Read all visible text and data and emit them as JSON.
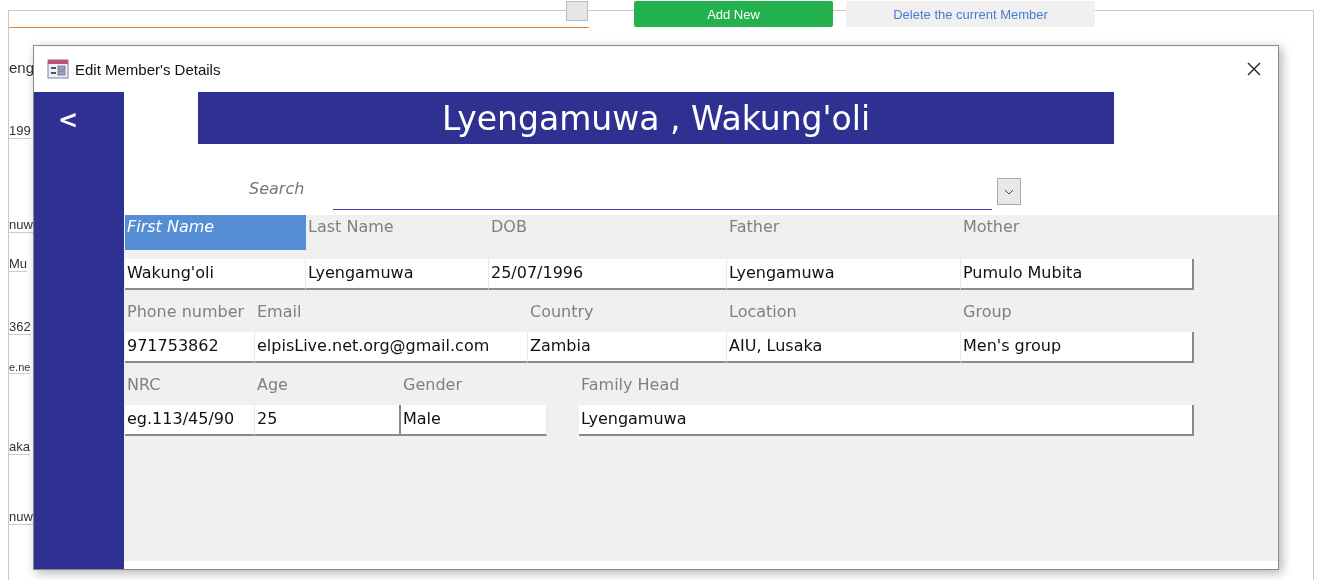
{
  "background_window": {
    "buttons": [
      {
        "label": "Add New",
        "kind": "primary"
      },
      {
        "label": "Delete the current Member",
        "kind": "secondary"
      }
    ],
    "fragments": [
      "eng",
      "199",
      "nuw",
      "Mu",
      "362",
      "e.ne",
      "aka",
      "nuw"
    ]
  },
  "dialog": {
    "title": "Edit Member's Details",
    "back": "<",
    "header": "Lyengamuwa , Wakung'oli",
    "search": {
      "label": "Search"
    },
    "rows": [
      [
        {
          "label": "First Name",
          "value": "Wakung'oli",
          "selected": true,
          "kind": "text"
        },
        {
          "label": "Last Name",
          "value": "Lyengamuwa",
          "selected": false,
          "kind": "text"
        },
        {
          "label": "DOB",
          "value": "25/07/1996",
          "selected": false,
          "kind": "text"
        },
        {
          "label": "Father",
          "value": "Lyengamuwa",
          "selected": false,
          "kind": "text"
        },
        {
          "label": "Mother",
          "value": "Pumulo Mubita",
          "selected": false,
          "kind": "text"
        }
      ],
      [
        {
          "label": "Phone number",
          "value": "971753862",
          "selected": false,
          "kind": "text"
        },
        {
          "label": "Email",
          "value": "elpisLive.net.org@gmail.com",
          "selected": false,
          "kind": "text"
        },
        {
          "label": "Country",
          "value": "Zambia",
          "selected": false,
          "kind": "text"
        },
        {
          "label": "Location",
          "value": "AIU, Lusaka",
          "selected": false,
          "kind": "text"
        },
        {
          "label": "Group",
          "value": "Men's group",
          "selected": false,
          "kind": "text"
        }
      ],
      [
        {
          "label": "NRC",
          "value": "eg.113/45/90",
          "selected": false,
          "kind": "text"
        },
        {
          "label": "Age",
          "value": "25",
          "selected": false,
          "kind": "number"
        },
        {
          "label": "Gender",
          "value": "Male",
          "selected": false,
          "kind": "text"
        },
        {
          "label": "Family Head",
          "value": "Lyengamuwa",
          "selected": false,
          "kind": "text"
        }
      ]
    ]
  }
}
